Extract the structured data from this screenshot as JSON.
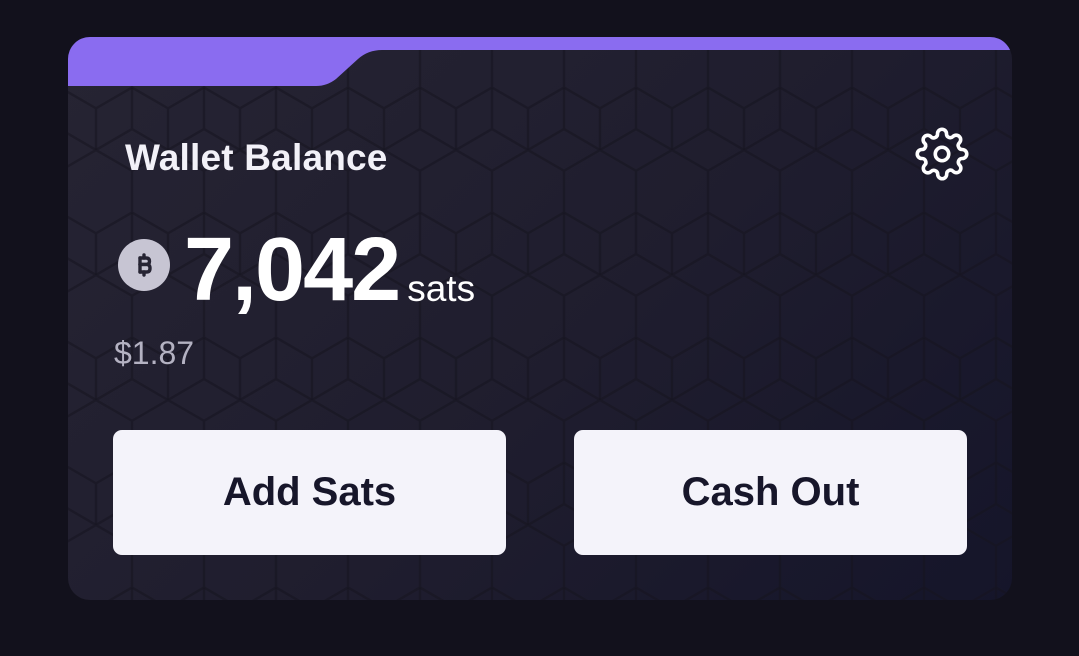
{
  "wallet": {
    "title": "Wallet Balance",
    "balance": "7,042",
    "unit": "sats",
    "fiat_value": "$1.87",
    "coin_icon": "bitcoin-coin-icon",
    "settings_icon": "gear-icon"
  },
  "actions": {
    "add_label": "Add Sats",
    "cashout_label": "Cash Out"
  },
  "colors": {
    "accent": "#8a6cf0",
    "card_bg": "#232130",
    "page_bg": "#12111c",
    "button_bg": "#f4f3fa",
    "button_text": "#17162a",
    "muted_text": "#b4b2c2"
  }
}
